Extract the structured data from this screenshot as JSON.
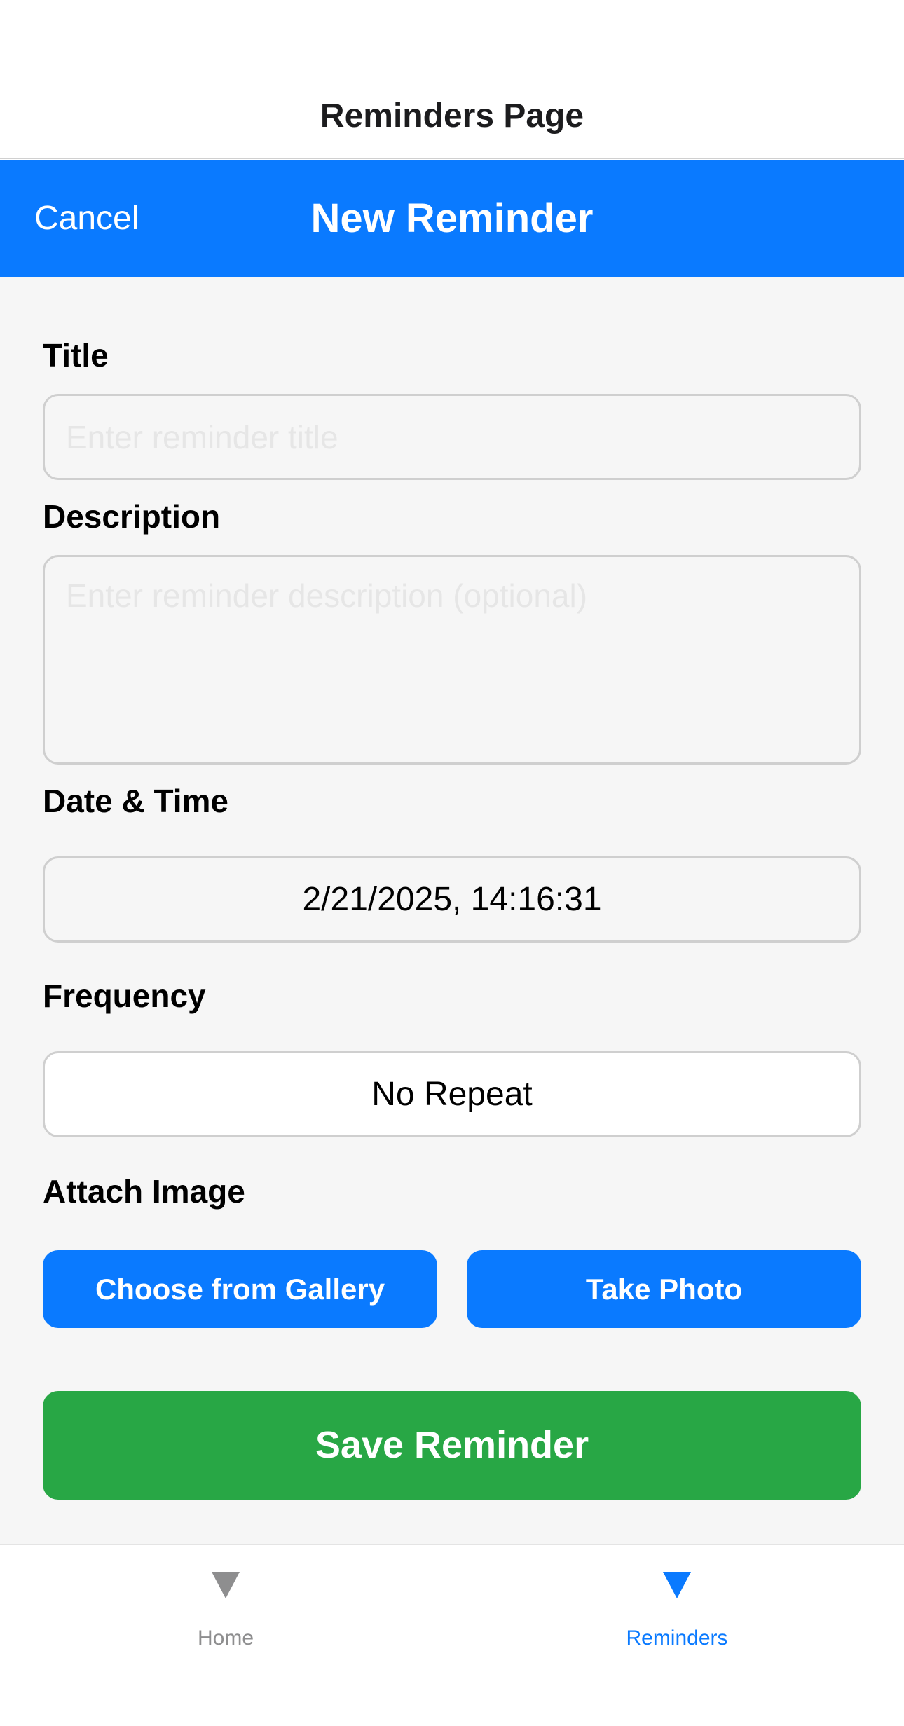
{
  "header": {
    "title": "Reminders Page"
  },
  "modal": {
    "cancel_label": "Cancel",
    "title": "New Reminder"
  },
  "form": {
    "title_label": "Title",
    "title_placeholder": "Enter reminder title",
    "title_value": "",
    "description_label": "Description",
    "description_placeholder": "Enter reminder description (optional)",
    "description_value": "",
    "datetime_label": "Date & Time",
    "datetime_value": "2/21/2025, 14:16:31",
    "frequency_label": "Frequency",
    "frequency_value": "No Repeat",
    "attach_label": "Attach Image",
    "gallery_button": "Choose from Gallery",
    "photo_button": "Take Photo",
    "save_button": "Save Reminder"
  },
  "tabbar": {
    "tabs": [
      {
        "label": "Home",
        "icon": "triangle-down-icon",
        "active": false
      },
      {
        "label": "Reminders",
        "icon": "triangle-down-icon",
        "active": true
      }
    ]
  },
  "colors": {
    "accent": "#0a7aff",
    "save": "#28a745",
    "inactive_tab": "#8e8e8f",
    "form_background": "#f6f6f6"
  }
}
